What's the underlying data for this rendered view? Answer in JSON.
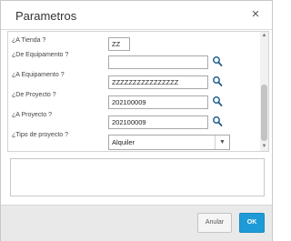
{
  "window": {
    "title": "Parametros",
    "close_glyph": "×"
  },
  "params": [
    {
      "label": "¿A Tienda ?",
      "value": "ZZ",
      "has_search": false
    },
    {
      "label": "¿De Equipamento ?",
      "value": "",
      "has_search": true
    },
    {
      "label": "¿A Equipamento ?",
      "value": "ZZZZZZZZZZZZZZZZ",
      "has_search": true
    },
    {
      "label": "¿De Proyecto ?",
      "value": "202100009",
      "has_search": true
    },
    {
      "label": "¿A Proyecto ?",
      "value": "202100009",
      "has_search": true
    },
    {
      "label": "¿Tipo de proyecto ?",
      "value": "Alquiler",
      "type": "select",
      "arrow_glyph": "▼"
    }
  ],
  "scrollbar": {
    "up_glyph": "▲",
    "down_glyph": "▼"
  },
  "message_box": {
    "text": ""
  },
  "footer": {
    "cancel_label": "Anular",
    "ok_label": "OK"
  },
  "colors": {
    "ok_button": "#1e9bd7",
    "search_icon": "#1f5f8f"
  },
  "icons": {
    "close": "close-icon",
    "search": "search-icon",
    "dropdown": "chevron-down-icon"
  }
}
